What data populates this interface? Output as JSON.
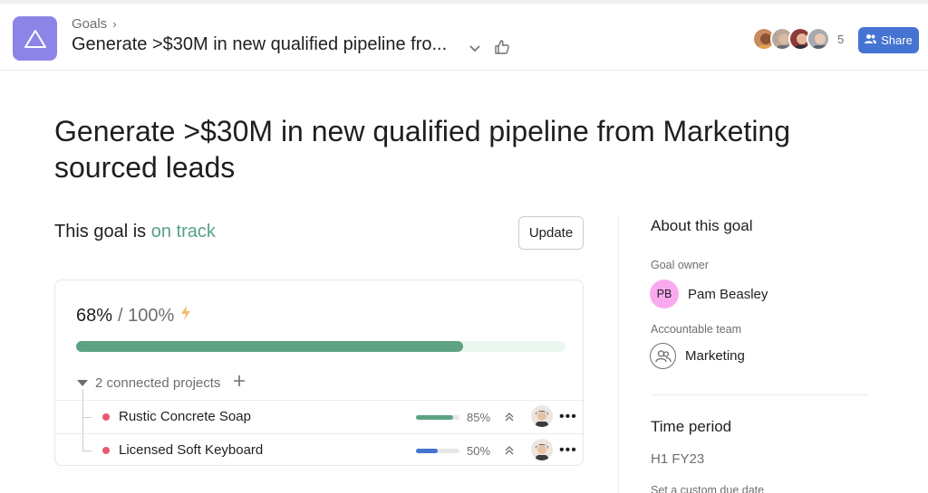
{
  "header": {
    "breadcrumb": "Goals",
    "title": "Generate >$30M in new qualified pipeline fro...",
    "member_count": "5",
    "share_label": "Share"
  },
  "goal": {
    "title": "Generate >$30M in new qualified pipeline from Marketing sourced leads",
    "status_prefix": "This goal is",
    "status_word": "on track",
    "update_label": "Update"
  },
  "progress": {
    "current": "68%",
    "total": "/ 100%",
    "fraction": 0.79
  },
  "projects": {
    "header": "2 connected projects",
    "items": [
      {
        "name": "Rustic Concrete Soap",
        "percent": "85%",
        "fill": 0.85,
        "dot_color": "#e8596f",
        "bar_color": "#5da283"
      },
      {
        "name": "Licensed Soft Keyboard",
        "percent": "50%",
        "fill": 0.5,
        "dot_color": "#e8596f",
        "bar_color": "#4573d2"
      }
    ]
  },
  "about": {
    "title": "About this goal",
    "owner_label": "Goal owner",
    "owner_initials": "PB",
    "owner_name": "Pam Beasley",
    "team_label": "Accountable team",
    "team_name": "Marketing",
    "time_title": "Time period",
    "time_value": "H1 FY23",
    "due_link": "Set a custom due date"
  },
  "colors": {
    "accent": "#4573d2",
    "goal_logo": "#8d84e8",
    "on_track": "#58a182"
  }
}
